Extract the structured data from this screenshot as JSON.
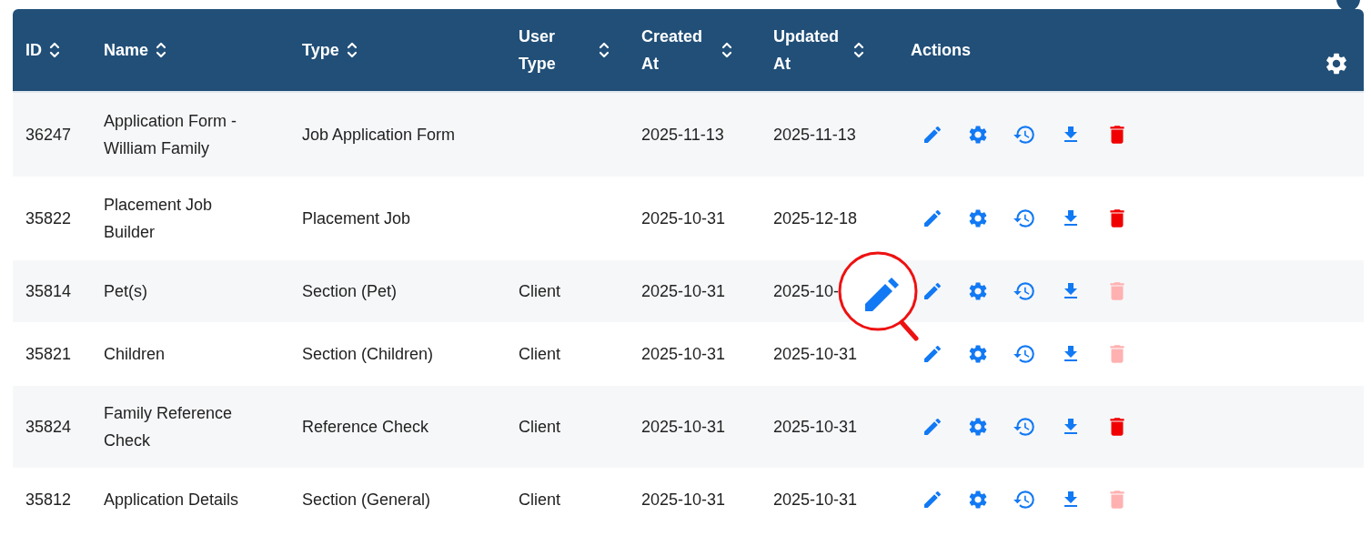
{
  "columns": [
    {
      "label": "ID",
      "sortable": true
    },
    {
      "label": "Name",
      "sortable": true
    },
    {
      "label": "Type",
      "sortable": true
    },
    {
      "label": "User Type",
      "sortable": true
    },
    {
      "label": "Created At",
      "sortable": true
    },
    {
      "label": "Updated At",
      "sortable": true
    },
    {
      "label": "Actions",
      "sortable": false
    }
  ],
  "rows": [
    {
      "id": "36247",
      "name": [
        "Application Form -",
        "William Family"
      ],
      "type": "Job Application Form",
      "user_type": "",
      "created": "2025-11-13",
      "updated": "2025-11-13",
      "delete_disabled": false
    },
    {
      "id": "35822",
      "name": [
        "Placement Job",
        "Builder"
      ],
      "type": "Placement Job",
      "user_type": "",
      "created": "2025-10-31",
      "updated": "2025-12-18",
      "delete_disabled": false
    },
    {
      "id": "35814",
      "name": [
        "Pet(s)"
      ],
      "type": "Section (Pet)",
      "user_type": "Client",
      "created": "2025-10-31",
      "updated": "2025-10-",
      "delete_disabled": true
    },
    {
      "id": "35821",
      "name": [
        "Children"
      ],
      "type": "Section (Children)",
      "user_type": "Client",
      "created": "2025-10-31",
      "updated": "2025-10-31",
      "delete_disabled": true
    },
    {
      "id": "35824",
      "name": [
        "Family Reference",
        "Check"
      ],
      "type": "Reference Check",
      "user_type": "Client",
      "created": "2025-10-31",
      "updated": "2025-10-31",
      "delete_disabled": false
    },
    {
      "id": "35812",
      "name": [
        "Application Details"
      ],
      "type": "Section (General)",
      "user_type": "Client",
      "created": "2025-10-31",
      "updated": "2025-10-31",
      "delete_disabled": true
    }
  ]
}
